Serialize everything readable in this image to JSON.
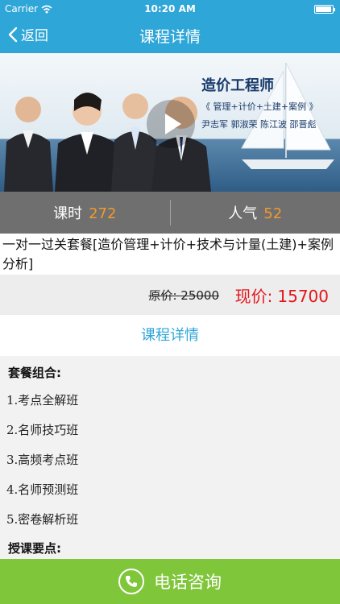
{
  "status_bar": {
    "carrier": "Carrier",
    "time": "10:20 AM",
    "battery_level": 0.95
  },
  "nav": {
    "back_label": "返回",
    "title": "课程详情"
  },
  "hero": {
    "title": "造价工程师",
    "subtitle": "《 管理+计价+土建+案例 》",
    "names": "尹志军 郭淑荣 陈江波 邵晋彪"
  },
  "stats": {
    "hours_label": "课时",
    "hours_value": "272",
    "popularity_label": "人气",
    "popularity_value": "52"
  },
  "course": {
    "title": "一对一过关套餐[造价管理+计价+技术与计量(土建)+案例分析]"
  },
  "price": {
    "original_label": "原价:",
    "original_value": "25000",
    "current_label": "现价:",
    "current_value": "15700"
  },
  "tab": {
    "label": "课程详情"
  },
  "detail": {
    "package_heading": "套餐组合:",
    "items": [
      "1.考点全解班",
      "2.名师技巧班",
      "3.高频考点班",
      "4.名师预测班",
      "5.密卷解析班"
    ],
    "points_heading": "授课要点:"
  },
  "footer": {
    "label": "电话咨询"
  },
  "colors": {
    "accent": "#2fa6d8",
    "price_red": "#e4151a",
    "stat_orange": "#f29a2e",
    "call_green": "#7fc63a"
  }
}
